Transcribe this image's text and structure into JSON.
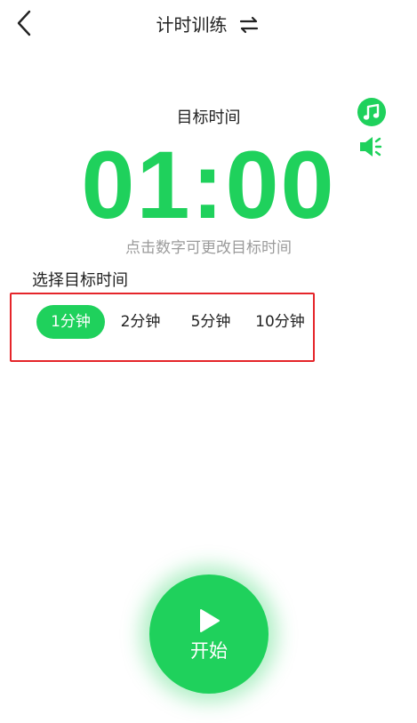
{
  "colors": {
    "accent": "#1fd15c",
    "highlight_border": "#e5252a",
    "hint_text": "#9b9b9b"
  },
  "header": {
    "title": "计时训练",
    "back_icon": "chevron-left-icon",
    "switch_icon": "swap-icon"
  },
  "side": {
    "music_icon": "music-note-icon",
    "volume_icon": "volume-icon"
  },
  "timer": {
    "label": "目标时间",
    "value": "01:00",
    "hint": "点击数字可更改目标时间"
  },
  "target_options": {
    "label": "选择目标时间",
    "items": [
      "1分钟",
      "2分钟",
      "5分钟",
      "10分钟"
    ],
    "selected": "1分钟"
  },
  "start_button": {
    "label": "开始",
    "icon": "play-icon"
  }
}
